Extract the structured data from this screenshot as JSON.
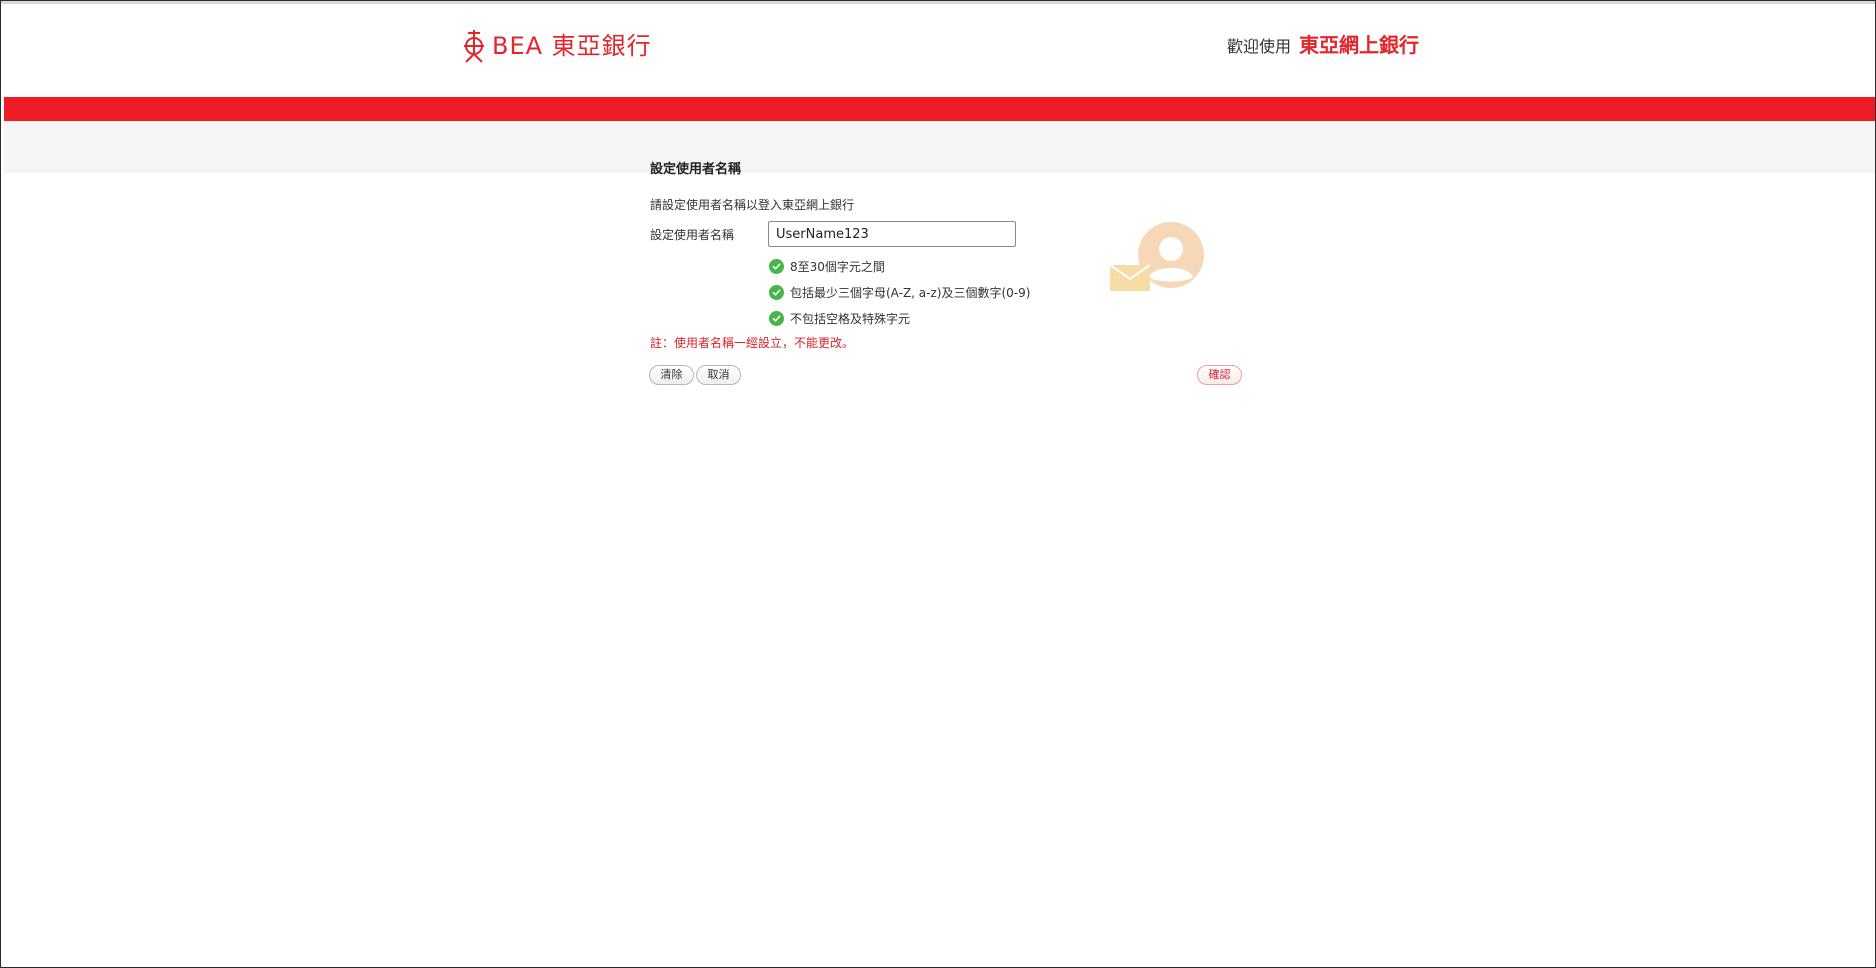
{
  "header": {
    "logo_text": "BEA 東亞銀行",
    "welcome_prefix": "歡迎使用",
    "welcome_brand": "東亞網上銀行"
  },
  "form": {
    "title": "設定使用者名稱",
    "intro": "請設定使用者名稱以登入東亞網上銀行",
    "username_label": "設定使用者名稱",
    "username_value": "UserName123",
    "rules": [
      {
        "text": "8至30個字元之間",
        "icon": "check-circle-icon"
      },
      {
        "text": "包括最少三個字母(A-Z, a-z)及三個數字(0-9)",
        "icon": "check-circle-icon"
      },
      {
        "text": "不包括空格及特殊字元",
        "icon": "check-circle-icon"
      }
    ],
    "note": "註：使用者名稱一經設立，不能更改。"
  },
  "buttons": {
    "clear": "清除",
    "cancel": "取消",
    "confirm": "確認"
  },
  "colors": {
    "brand_red": "#ee1c24",
    "check_green": "#45b649",
    "note_red": "#d9232d",
    "band_grey": "#f5f5f5"
  }
}
